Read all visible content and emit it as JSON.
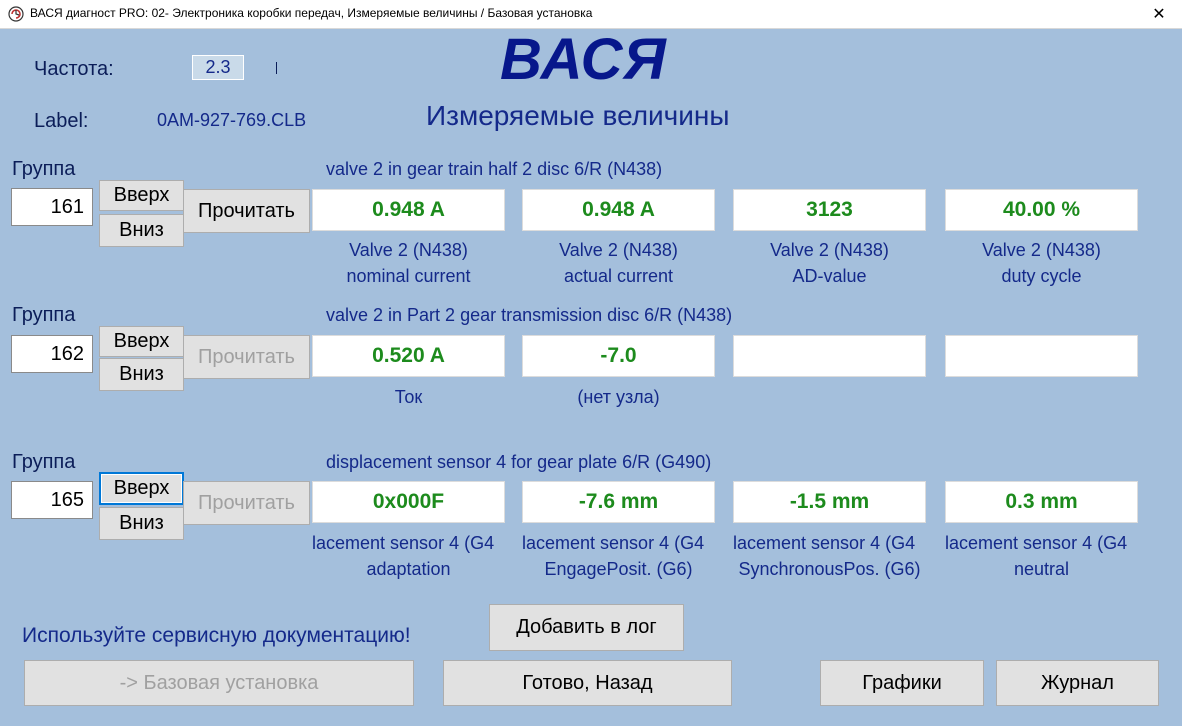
{
  "window": {
    "title": "ВАСЯ диагност PRO: 02- Электроника коробки передач,  Измеряемые величины / Базовая установка",
    "close_glyph": "✕"
  },
  "header": {
    "logo": "ВАСЯ",
    "subtitle": "Измеряемые величины",
    "freq_label": "Частота:",
    "freq_value": "2.3",
    "label_label": "Label:",
    "label_value": "0AM-927-769.CLB"
  },
  "group_label": "Группа",
  "buttons": {
    "up": "Вверх",
    "down": "Вниз",
    "read": "Прочитать"
  },
  "groups": [
    {
      "number": "161",
      "title": "valve 2 in gear train half 2 disc 6/R (N438)",
      "values": [
        "0.948 A",
        "0.948 A",
        "3123",
        "40.00 %"
      ],
      "captions": [
        [
          "Valve 2 (N438)",
          "nominal current"
        ],
        [
          "Valve 2 (N438)",
          "actual current"
        ],
        [
          "Valve 2 (N438)",
          "AD-value"
        ],
        [
          "Valve 2 (N438)",
          "duty cycle"
        ]
      ]
    },
    {
      "number": "162",
      "title": "valve 2 in Part 2 gear transmission disc 6/R (N438)",
      "values": [
        "0.520 A",
        "-7.0",
        "",
        ""
      ],
      "captions": [
        [
          "Ток",
          ""
        ],
        [
          "(нет узла)",
          ""
        ],
        [
          "",
          ""
        ],
        [
          "",
          ""
        ]
      ]
    },
    {
      "number": "165",
      "title": "displacement sensor 4 for gear plate 6/R (G490)",
      "values": [
        "0x000F",
        "-7.6 mm",
        "-1.5 mm",
        "0.3 mm"
      ],
      "captions": [
        [
          "lacement sensor 4 (G4",
          "adaptation"
        ],
        [
          "lacement sensor 4 (G4",
          "EngagePosit. (G6)"
        ],
        [
          "lacement sensor 4 (G4",
          "SynchronousPos. (G6)"
        ],
        [
          "lacement sensor 4 (G4",
          "neutral"
        ]
      ]
    }
  ],
  "footer": {
    "doc_note": "Используйте сервисную документацию!",
    "add_log": "Добавить в лог",
    "basic_setting": "-> Базовая установка",
    "done_back": "Готово, Назад",
    "graphs": "Графики",
    "journal": "Журнал"
  },
  "colors": {
    "background": "#a4bfdc",
    "value_text": "#1d8b1d",
    "label_text": "#14298a",
    "logo": "#07178b"
  }
}
